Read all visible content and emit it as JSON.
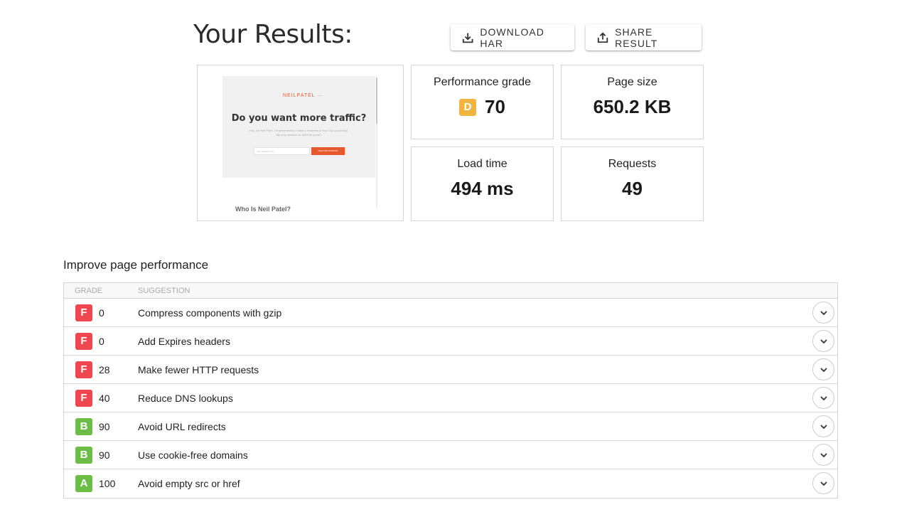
{
  "title": "Your Results:",
  "buttons": {
    "download_har": "DOWNLOAD HAR",
    "share_result": "SHARE RESULT"
  },
  "screenshot": {
    "logo": "NEILPATEL",
    "headline": "Do you want more traffic?",
    "subtext": "Hey, I'm Neil Patel. I'm determined to make a business in Your City successful. My only question is, will it be yours?",
    "input_placeholder": "Your Website URL",
    "cta": "ANALYZE WEBSITE",
    "footer": "Who Is Neil Patel?"
  },
  "metrics": {
    "performance": {
      "label": "Performance grade",
      "grade": "D",
      "value": "70",
      "color": "#f0b43f"
    },
    "page_size": {
      "label": "Page size",
      "value": "650.2 KB"
    },
    "load_time": {
      "label": "Load time",
      "value": "494 ms"
    },
    "requests": {
      "label": "Requests",
      "value": "49"
    }
  },
  "section_title": "Improve page performance",
  "table": {
    "headers": {
      "grade": "GRADE",
      "suggestion": "SUGGESTION"
    },
    "rows": [
      {
        "grade": "F",
        "score": "0",
        "suggestion": "Compress components with gzip",
        "color": "#f0474f"
      },
      {
        "grade": "F",
        "score": "0",
        "suggestion": "Add Expires headers",
        "color": "#f0474f"
      },
      {
        "grade": "F",
        "score": "28",
        "suggestion": "Make fewer HTTP requests",
        "color": "#f0474f"
      },
      {
        "grade": "F",
        "score": "40",
        "suggestion": "Reduce DNS lookups",
        "color": "#f0474f"
      },
      {
        "grade": "B",
        "score": "90",
        "suggestion": "Avoid URL redirects",
        "color": "#6bbd45"
      },
      {
        "grade": "B",
        "score": "90",
        "suggestion": "Use cookie-free domains",
        "color": "#6bbd45"
      },
      {
        "grade": "A",
        "score": "100",
        "suggestion": "Avoid empty src or href",
        "color": "#6bbd45"
      }
    ]
  }
}
